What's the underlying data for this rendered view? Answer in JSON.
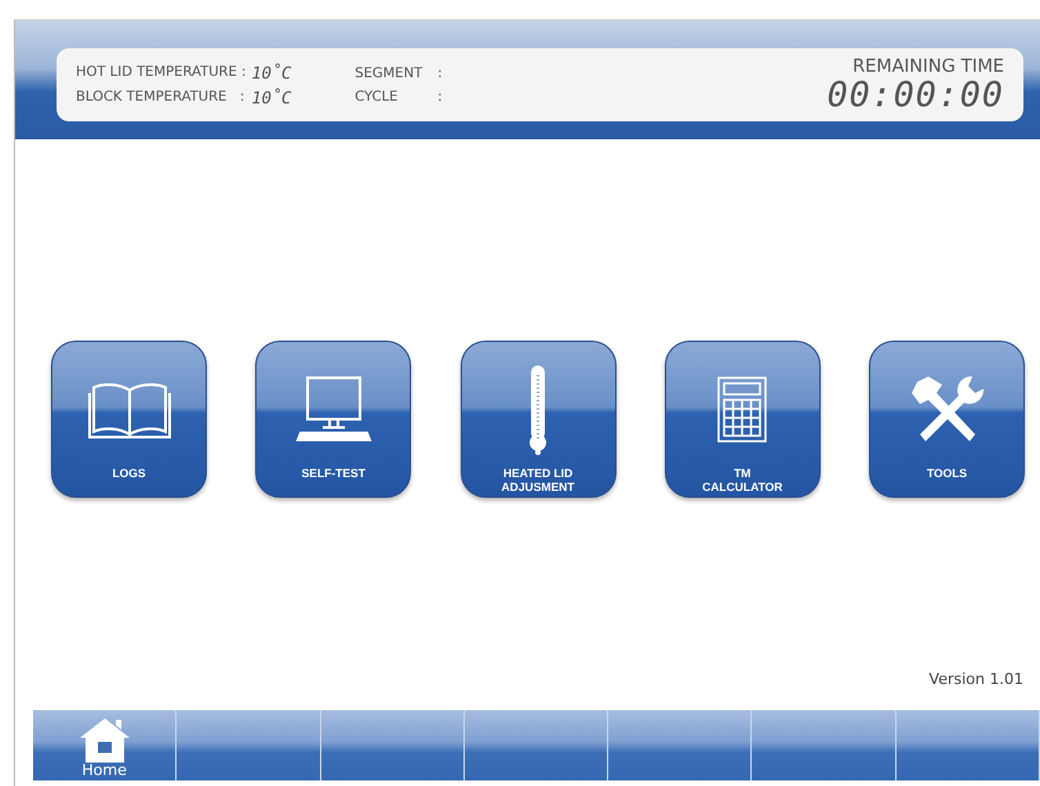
{
  "status_panel": {
    "readings": [
      {
        "label": "HOT LID TEMPERATURE :",
        "value": "10˚C"
      },
      {
        "label": "BLOCK TEMPERATURE   :",
        "value": "10˚C"
      }
    ],
    "progress": [
      {
        "label": "SEGMENT",
        "sep": ":"
      },
      {
        "label": "CYCLE",
        "sep": ":"
      }
    ],
    "remaining_label": "REMAINING TIME",
    "remaining_value": "00:00:00"
  },
  "menu": [
    {
      "kind": "book",
      "label": "LOGS"
    },
    {
      "kind": "monitor",
      "label": "SELF-TEST"
    },
    {
      "kind": "thermometer",
      "label": "HEATED LID ADJUSMENT"
    },
    {
      "kind": "calculator",
      "label": "TM CALCULATOR"
    },
    {
      "kind": "tools",
      "label": "TOOLS"
    }
  ],
  "version": "Version 1.01",
  "nav": [
    {
      "kind": "home",
      "label": "Home"
    },
    {
      "kind": "blank"
    },
    {
      "kind": "blank"
    },
    {
      "kind": "blank"
    },
    {
      "kind": "blank"
    },
    {
      "kind": "blank"
    },
    {
      "kind": "blank"
    }
  ]
}
